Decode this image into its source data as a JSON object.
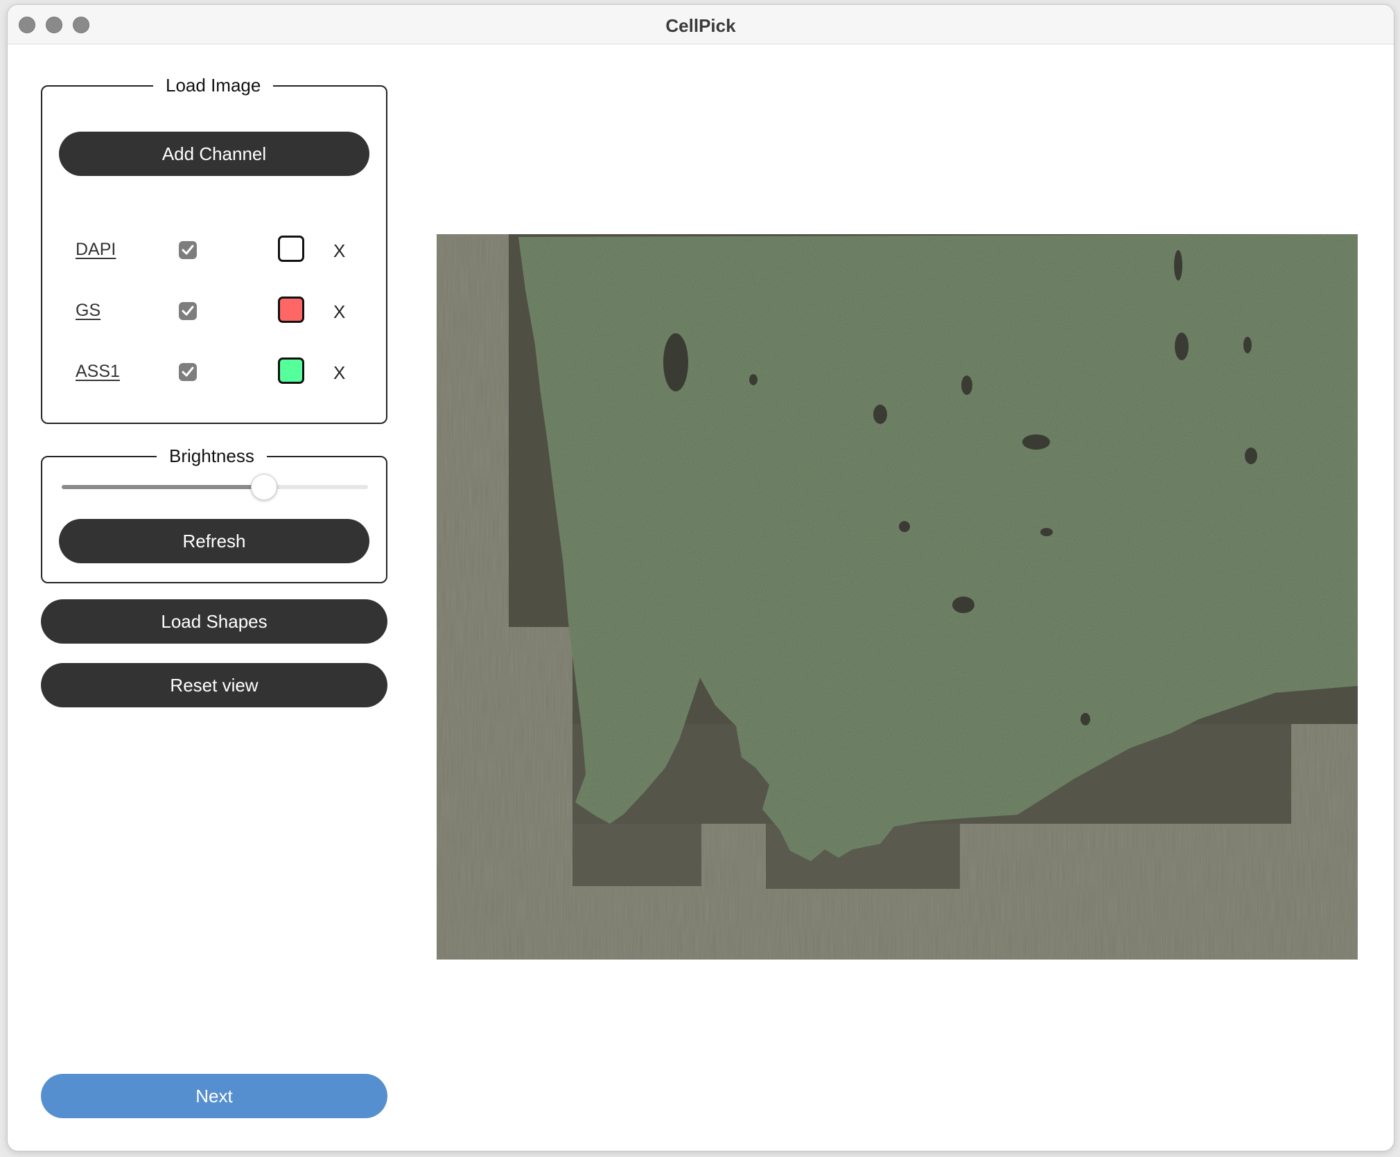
{
  "window": {
    "title": "CellPick"
  },
  "load_image": {
    "legend": "Load Image",
    "add_channel_label": "Add Channel",
    "channels": [
      {
        "name": "DAPI",
        "checked": true,
        "color": "#ffffff",
        "remove_label": "X"
      },
      {
        "name": "GS",
        "checked": true,
        "color": "#ff6666",
        "remove_label": "X"
      },
      {
        "name": "ASS1",
        "checked": true,
        "color": "#55ff99",
        "remove_label": "X"
      }
    ]
  },
  "brightness": {
    "legend": "Brightness",
    "value_fraction": 0.66,
    "refresh_label": "Refresh"
  },
  "actions": {
    "load_shapes_label": "Load Shapes",
    "reset_view_label": "Reset view",
    "next_label": "Next"
  },
  "colors": {
    "button_dark": "#333333",
    "button_primary": "#558fcf",
    "tissue_green": "#5f7356",
    "background_gray": "#7a7a6a"
  }
}
